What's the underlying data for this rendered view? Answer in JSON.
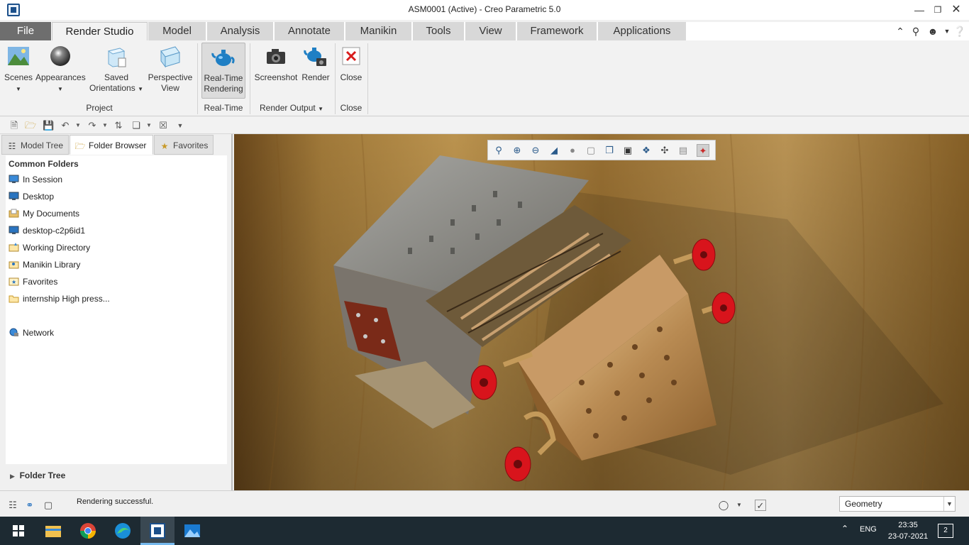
{
  "window": {
    "title": "ASM0001 (Active) - Creo Parametric 5.0",
    "controls": [
      "minimize",
      "restore",
      "close"
    ]
  },
  "ribbon_tabs": [
    {
      "label": "File"
    },
    {
      "label": "Render Studio"
    },
    {
      "label": "Model"
    },
    {
      "label": "Analysis"
    },
    {
      "label": "Annotate"
    },
    {
      "label": "Manikin"
    },
    {
      "label": "Tools"
    },
    {
      "label": "View"
    },
    {
      "label": "Framework"
    },
    {
      "label": "Applications"
    }
  ],
  "active_tab": "Render Studio",
  "ribbon": {
    "scenes": "Scenes",
    "appearances": "Appearances",
    "saved_orientations_1": "Saved",
    "saved_orientations_2": "Orientations",
    "perspective_1": "Perspective",
    "perspective_2": "View",
    "realtime_1": "Real-Time",
    "realtime_2": "Rendering",
    "screenshot": "Screenshot",
    "render": "Render",
    "close": "Close",
    "groups": {
      "project": "Project",
      "realtime": "Real-Time",
      "render_output": "Render Output",
      "close": "Close"
    }
  },
  "left_panel": {
    "tabs": [
      "Model Tree",
      "Folder Browser",
      "Favorites"
    ],
    "active_tab": "Folder Browser",
    "common_folders_header": "Common Folders",
    "folders": [
      "In Session",
      "Desktop",
      "My Documents",
      "desktop-c2p6id1",
      "Working Directory",
      "Manikin Library",
      "Favorites",
      "internship High press...",
      "Network"
    ],
    "folder_tree": "Folder Tree"
  },
  "status": {
    "message": "Rendering successful.",
    "filter_value": "Geometry"
  },
  "taskbar": {
    "language": "ENG",
    "time": "23:35",
    "date": "23-07-2021",
    "notifications": "2"
  },
  "colors": {
    "file_tab": "#6e6e6e",
    "ribbon_bg": "#f2f2f2",
    "flange_red": "#d8141c",
    "wood": "#a87f3c",
    "taskbar": "#1d2a32"
  }
}
